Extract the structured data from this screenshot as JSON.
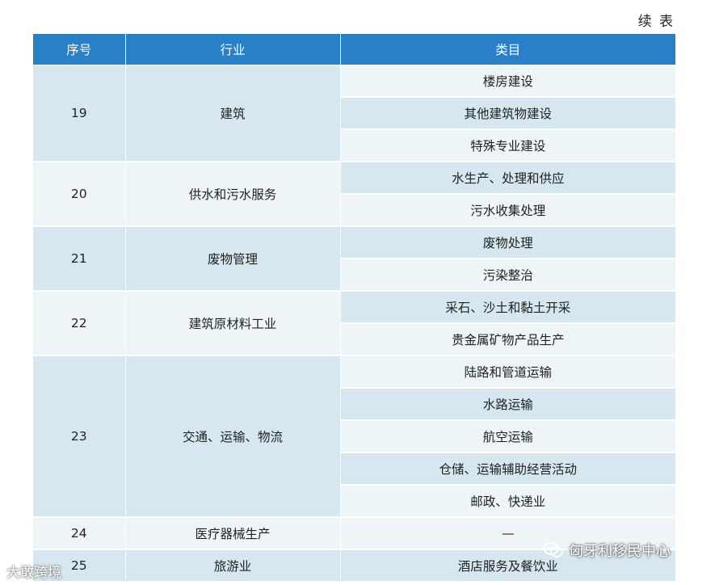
{
  "caption": "续 表",
  "table": {
    "headers": [
      "序号",
      "行业",
      "类目"
    ],
    "rows": [
      {
        "no": "19",
        "industry": "建筑",
        "items": [
          "楼房建设",
          "其他建筑物建设",
          "特殊专业建设"
        ]
      },
      {
        "no": "20",
        "industry": "供水和污水服务",
        "items": [
          "水生产、处理和供应",
          "污水收集处理"
        ]
      },
      {
        "no": "21",
        "industry": "废物管理",
        "items": [
          "废物处理",
          "污染整治"
        ]
      },
      {
        "no": "22",
        "industry": "建筑原材料工业",
        "items": [
          "采石、沙土和黏土开采",
          "贵金属矿物产品生产"
        ]
      },
      {
        "no": "23",
        "industry": "交通、运输、物流",
        "items": [
          "陆路和管道运输",
          "水路运输",
          "航空运输",
          "仓储、运输辅助经营活动",
          "邮政、快递业"
        ]
      },
      {
        "no": "24",
        "industry": "医疗器械生产",
        "items": [
          "—"
        ]
      },
      {
        "no": "25",
        "industry": "旅游业",
        "items": [
          "酒店服务及餐饮业"
        ]
      }
    ]
  },
  "watermark": {
    "text": "匈牙利移民中心",
    "icon": "wechat-icon"
  },
  "watermark_left": "大敢跨境",
  "colors": {
    "header_bg": "#2a80c6",
    "row_dark": "#d6e7ef",
    "row_light": "#eef5f8"
  }
}
